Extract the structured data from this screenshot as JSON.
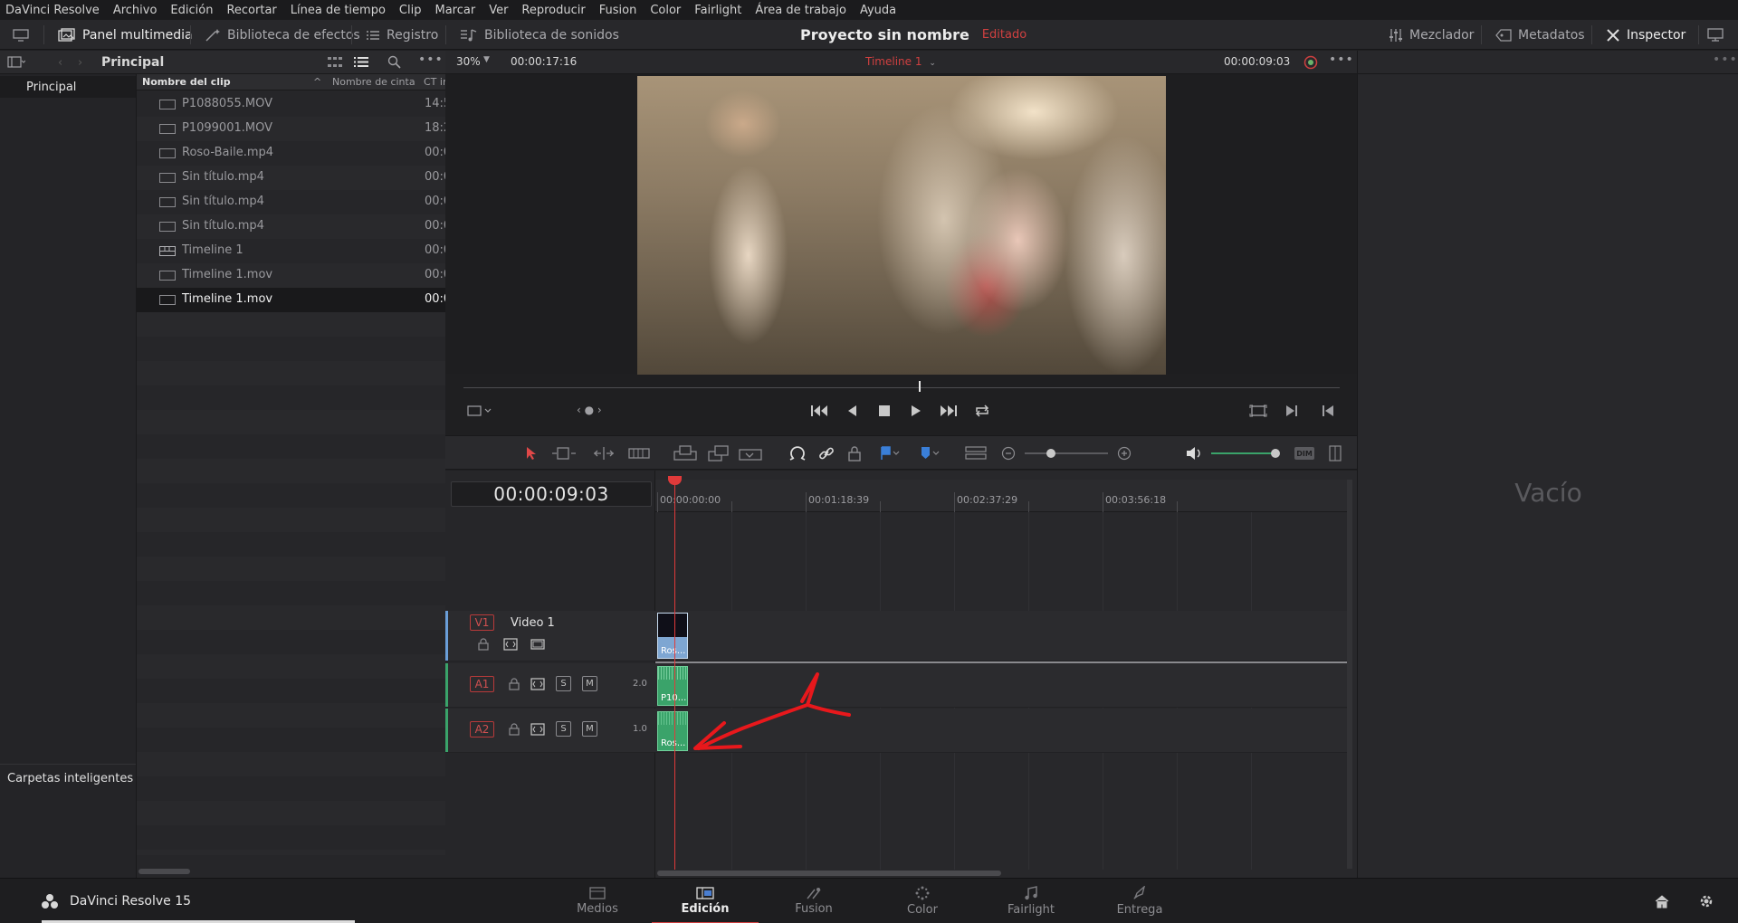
{
  "menu": [
    "DaVinci Resolve",
    "Archivo",
    "Edición",
    "Recortar",
    "Línea de tiempo",
    "Clip",
    "Marcar",
    "Ver",
    "Reproducir",
    "Fusion",
    "Color",
    "Fairlight",
    "Área de trabajo",
    "Ayuda"
  ],
  "toolbar": {
    "media_pool": "Panel multimedia",
    "effects_library": "Biblioteca de efectos",
    "edit_index": "Registro",
    "sound_library": "Biblioteca de sonidos",
    "project_name": "Proyecto sin nombre",
    "project_status": "Editado",
    "mixer": "Mezclador",
    "metadata": "Metadatos",
    "inspector": "Inspector"
  },
  "media_pool": {
    "current_bin": "Principal",
    "bins": [
      "Principal"
    ],
    "smart_bins": "Carpetas inteligentes",
    "columns": [
      "Nombre del clip",
      "Nombre de cinta",
      "CT ir"
    ],
    "clips": [
      {
        "name": "P1088055.MOV",
        "tc": "14:5",
        "icon": "video-clip-icon"
      },
      {
        "name": "P1099001.MOV",
        "tc": "18:2",
        "icon": "video-clip-icon"
      },
      {
        "name": "Roso-Baile.mp4",
        "tc": "00:0",
        "icon": "video-clip-icon"
      },
      {
        "name": "Sin título.mp4",
        "tc": "00:0",
        "icon": "video-clip-icon"
      },
      {
        "name": "Sin título.mp4",
        "tc": "00:0",
        "icon": "video-clip-icon"
      },
      {
        "name": "Sin título.mp4",
        "tc": "00:0",
        "icon": "video-clip-icon"
      },
      {
        "name": "Timeline 1",
        "tc": "00:0",
        "icon": "timeline-icon"
      },
      {
        "name": "Timeline 1.mov",
        "tc": "00:0",
        "icon": "video-clip-icon"
      },
      {
        "name": "Timeline 1.mov",
        "tc": "00:0",
        "icon": "video-clip-icon"
      }
    ],
    "selected_clip_index": 8
  },
  "viewer": {
    "zoom": "30%",
    "duration": "00:00:17:16",
    "timeline_name": "Timeline 1",
    "timecode": "00:00:09:03",
    "scrub_position": 0.52
  },
  "timeline": {
    "timecode": "00:00:09:03",
    "ruler": [
      "00:00:00:00",
      "00:01:18:39",
      "00:02:37:29",
      "00:03:56:18"
    ],
    "video_track": {
      "tag": "V1",
      "name": "Video 1",
      "clip_label": "Ros..."
    },
    "audio_tracks": [
      {
        "tag": "A1",
        "solo": "S",
        "mute": "M",
        "channels": "2.0",
        "clip_label": "P10..."
      },
      {
        "tag": "A2",
        "solo": "S",
        "mute": "M",
        "channels": "1.0",
        "clip_label": "Ros..."
      }
    ]
  },
  "inspector": {
    "empty_text": "Vacío"
  },
  "pages": [
    "Medios",
    "Edición",
    "Fusion",
    "Color",
    "Fairlight",
    "Entrega"
  ],
  "active_page": "Edición",
  "product": "DaVinci Resolve 15",
  "colors": {
    "accent_red": "#d04040",
    "video_clip": "#7ea6d2",
    "audio_clip": "#3aa36a",
    "annotation": "#e8181c"
  }
}
